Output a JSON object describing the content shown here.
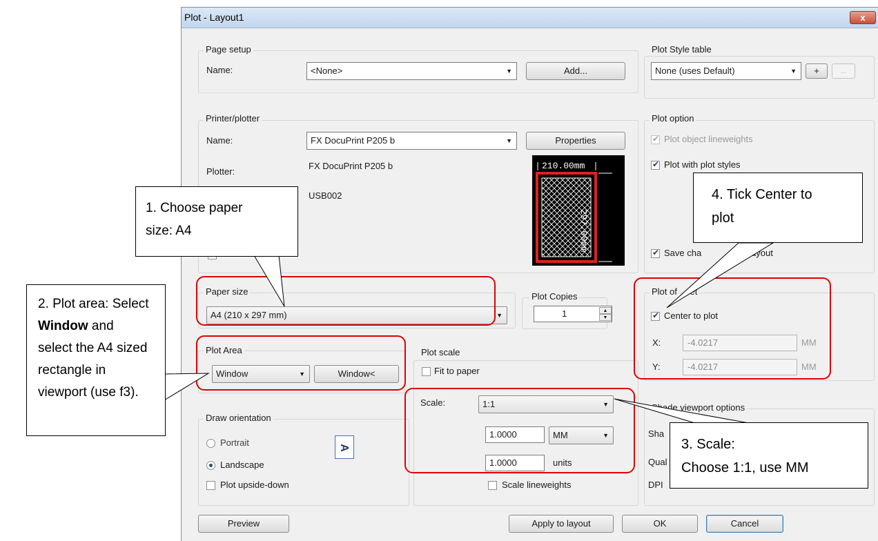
{
  "dialog": {
    "title": "Plot - Layout1",
    "close_glyph": "x"
  },
  "page_setup": {
    "group_label": "Page setup",
    "name_label": "Name:",
    "name_value": "<None>",
    "add_button": "Add..."
  },
  "printer": {
    "group_label": "Printer/plotter",
    "name_label": "Name:",
    "name_value": "FX DocuPrint P205 b",
    "properties_button": "Properties",
    "plotter_label": "Plotter:",
    "plotter_value": "FX DocuPrint P205 b",
    "where_value": "USB002",
    "preview_width": "210.00mm",
    "preview_height": "297.00mm"
  },
  "paper_size": {
    "group_label": "Paper size",
    "value": "A4 (210 x 297 mm)"
  },
  "plot_copies": {
    "group_label": "Plot Copies",
    "value": "1"
  },
  "plot_area": {
    "group_label": "Plot Area",
    "what_to_plot": "Window",
    "window_button": "Window<"
  },
  "plot_scale": {
    "group_label": "Plot scale",
    "fit_label": "Fit to paper",
    "scale_label": "Scale:",
    "scale_value": "1:1",
    "value1": "1.0000",
    "unit1": "MM",
    "value2": "1.0000",
    "unit2": "units",
    "scale_lineweights": "Scale lineweights"
  },
  "draw_orientation": {
    "group_label": "Draw orientation",
    "portrait": "Portrait",
    "landscape": "Landscape",
    "upside_down": "Plot upside-down",
    "orientation_glyph": "A"
  },
  "plot_style_table": {
    "group_label": "Plot Style table",
    "value": "None (uses Default)",
    "plus_button": "+",
    "edit_button": "..."
  },
  "plot_options": {
    "group_label": "Plot option",
    "lineweights": "Plot object lineweights",
    "plot_styles": "Plot with plot styles",
    "save_changes": "Save cha",
    "save_changes_tail": "ayout"
  },
  "plot_offset": {
    "group_label": "Plot of",
    "group_label_tail": "set",
    "center": "Center to plot",
    "x_label": "X:",
    "x_value": "-4.0217",
    "x_unit": "MM",
    "y_label": "Y:",
    "y_value": "-4.0217",
    "y_unit": "MM"
  },
  "shade": {
    "group_label": "Shade viewport options",
    "shade_label": "Sha",
    "quality_label": "Qual",
    "dpi_label": "DPI"
  },
  "buttons": {
    "preview": "Preview",
    "apply": "Apply to layout",
    "ok": "OK",
    "cancel": "Cancel"
  },
  "callouts": {
    "c1_line1": "1. Choose paper",
    "c1_line2": "size: A4",
    "c2_line1": "2. Plot area: Select",
    "c2_line2_bold": "Window",
    "c2_line2_rest": " and",
    "c2_line3": "select the A4 sized",
    "c2_line4": "rectangle in",
    "c2_line5": "viewport (use f3).",
    "c3_line1": "3. Scale:",
    "c3_line2": "Choose 1:1, use MM",
    "c4_line1": "4. Tick Center to",
    "c4_line2": "plot"
  },
  "colors": {
    "highlight": "#e00000",
    "title_bar": "#c3d6ee",
    "dialog_bg": "#f0f0f0"
  }
}
